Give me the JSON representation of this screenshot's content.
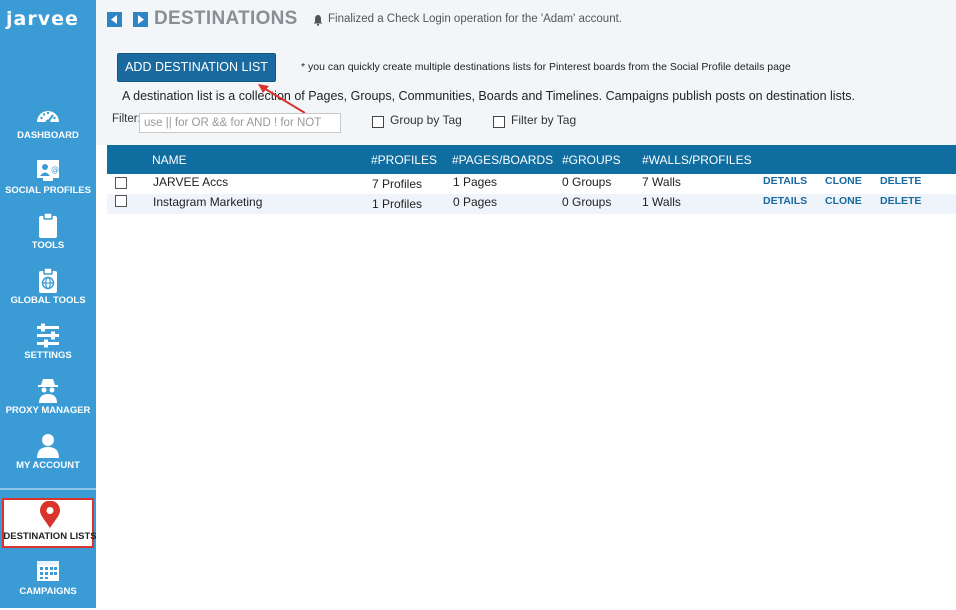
{
  "app": {
    "logo": "jarvee"
  },
  "sidebar": {
    "items": [
      {
        "label": "DASHBOARD",
        "icon": "dashboard-gauge-icon"
      },
      {
        "label": "SOCIAL PROFILES",
        "icon": "social-profiles-icon"
      },
      {
        "label": "TOOLS",
        "icon": "clipboard-icon"
      },
      {
        "label": "GLOBAL TOOLS",
        "icon": "globe-clipboard-icon"
      },
      {
        "label": "SETTINGS",
        "icon": "sliders-icon"
      },
      {
        "label": "PROXY MANAGER",
        "icon": "spy-icon"
      },
      {
        "label": "MY ACCOUNT",
        "icon": "user-icon"
      },
      {
        "label": "DESTINATION LISTS",
        "icon": "map-pin-icon",
        "active": true
      },
      {
        "label": "CAMPAIGNS",
        "icon": "calendar-icon"
      }
    ],
    "active_border_color": "#d9342b"
  },
  "header": {
    "title": "DESTINATIONS",
    "notification": "Finalized a Check Login operation for the 'Adam' account."
  },
  "toolbar": {
    "add_button": "ADD DESTINATION LIST",
    "hint": "* you can quickly create multiple destinations lists for Pinterest boards from the Social Profile details page",
    "description": "A destination list is a collection of Pages, Groups, Communities, Boards and Timelines. Campaigns publish posts on destination lists."
  },
  "filter": {
    "label": "Filter:",
    "placeholder": "use || for OR && for AND ! for NOT",
    "group_by_tag": "Group by Tag",
    "filter_by_tag": "Filter by Tag"
  },
  "table": {
    "columns": [
      "NAME",
      "#PROFILES",
      "#PAGES/BOARDS",
      "#GROUPS",
      "#WALLS/PROFILES"
    ],
    "rows": [
      {
        "name": "JARVEE Accs",
        "profiles": "7 Profiles",
        "pages": "1 Pages",
        "groups": "0 Groups",
        "walls": "7 Walls",
        "details": "DETAILS",
        "clone": "CLONE",
        "delete": "DELETE"
      },
      {
        "name": "Instagram Marketing",
        "profiles": "1 Profiles",
        "pages": "0 Pages",
        "groups": "0 Groups",
        "walls": "1 Walls",
        "details": "DETAILS",
        "clone": "CLONE",
        "delete": "DELETE"
      }
    ]
  },
  "colors": {
    "sidebar": "#3a9bd5",
    "header_bar": "#0f6d9f",
    "button": "#1a6aa0",
    "annotation_arrow": "#d9342b"
  }
}
